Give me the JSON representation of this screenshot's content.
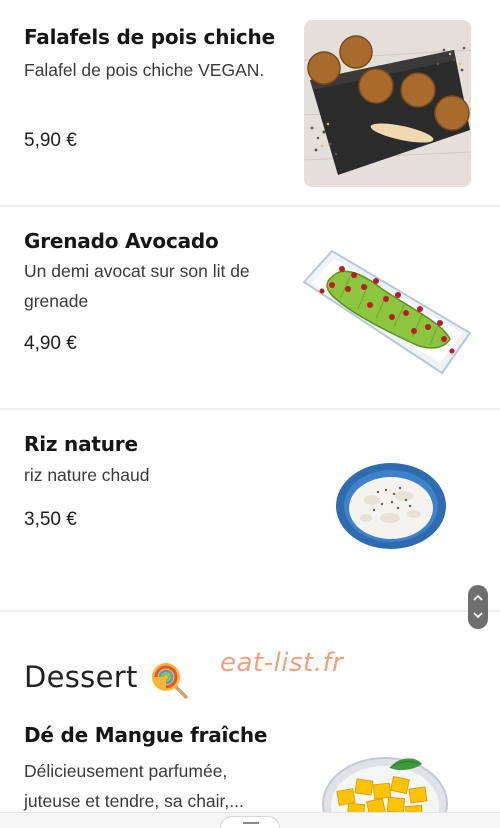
{
  "items": [
    {
      "name": "Falafels de pois chiche",
      "description": "Falafel de pois chiche VEGAN.",
      "price": "5,90 €"
    },
    {
      "name": "Grenado Avocado",
      "description": "Un demi avocat sur son lit de grenade",
      "price": "4,90 €"
    },
    {
      "name": "Riz nature",
      "description": "riz nature chaud",
      "price": "3,50 €"
    }
  ],
  "dessert_section": {
    "title": "Dessert",
    "icon": "lollipop-icon",
    "items": [
      {
        "name": "Dé de Mangue fraîche",
        "description": "Délicieusement parfumée, juteuse et tendre, sa chair,..."
      }
    ]
  },
  "watermark": "eat-list.fr",
  "colors": {
    "watermark": "#f2a07a",
    "divider": "#eeeeee",
    "scrollbar": "#6f6f6f"
  }
}
